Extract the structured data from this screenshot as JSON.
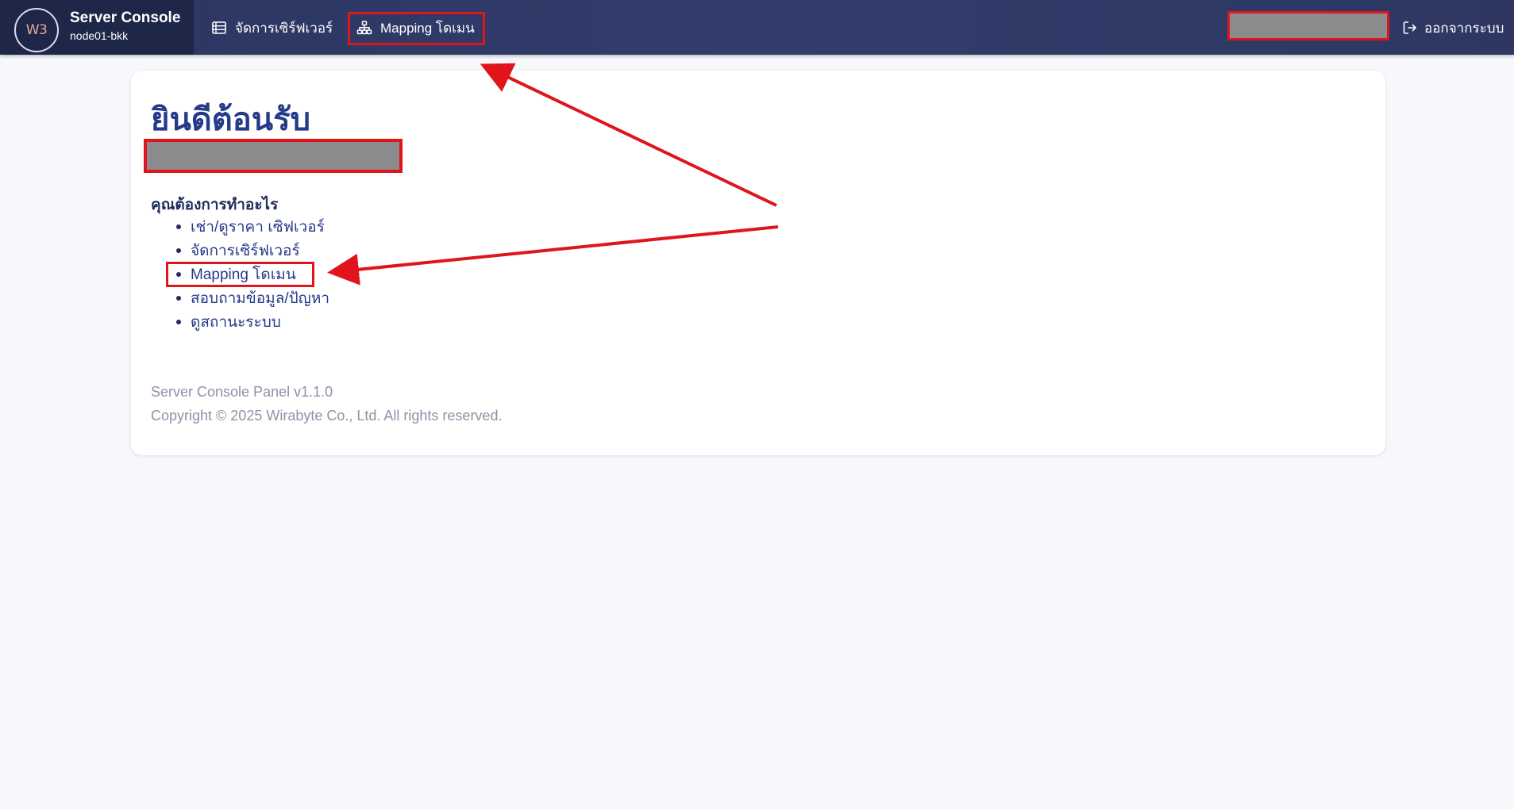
{
  "topbar": {
    "brand_logo": "W3",
    "brand_title": "Server Console",
    "brand_subtitle": "node01-bkk",
    "nav": [
      {
        "label": "จัดการเซิร์ฟเวอร์",
        "icon": "server-list-icon"
      },
      {
        "label": "Mapping โดเมน",
        "icon": "sitemap-icon"
      }
    ],
    "logout_label": "ออกจากระบบ",
    "logout_icon": "logout-icon"
  },
  "main": {
    "welcome_title": "ยินดีต้อนรับ",
    "question": "คุณต้องการทำอะไร",
    "menu": [
      "เช่า/ดูราคา เซิฟเวอร์",
      "จัดการเซิร์ฟเวอร์",
      "Mapping โดเมน",
      "สอบถามข้อมูล/ปัญหา",
      "ดูสถานะระบบ"
    ]
  },
  "footer": {
    "version": "Server Console Panel v1.1.0",
    "copyright": "Copyright © 2025 Wirabyte Co., Ltd. All rights reserved."
  },
  "colors": {
    "topbar": "#2b3560",
    "brand_bg": "#1f2748",
    "accent_title": "#253a8a",
    "highlight_red": "#e0151c",
    "redaction_gray": "#8b8b8e",
    "page_bg": "#f7f8fc"
  }
}
